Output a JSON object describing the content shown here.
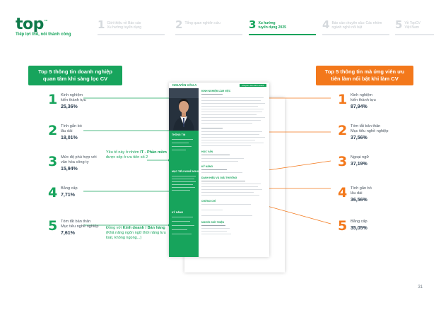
{
  "logo": {
    "text_top": "top",
    "text_cv": "cv",
    "tm": "™"
  },
  "tagline": "Tiếp lợi thế, nối thành công",
  "steps": [
    {
      "num": "1",
      "label": "Giới thiệu về Báo cáo\nXu hướng tuyển dụng",
      "active": false
    },
    {
      "num": "2",
      "label": "Tổng quan nghiên cứu",
      "active": false
    },
    {
      "num": "3",
      "label": "Xu hướng\ntuyển dụng 2025",
      "active": true
    },
    {
      "num": "4",
      "label": "Báo cáo chuyên sâu: Các nhóm\nngành nghề nổi bật",
      "active": false
    },
    {
      "num": "5",
      "label": "Về TopCV\nViệt Nam",
      "active": false
    }
  ],
  "left_box": "Top 5 thông tin doanh nghiệp\nquan tâm khi sàng lọc CV",
  "right_box": "Top 5 thông tin mà ứng viên ưu\ntiên làm nổi bật khi làm CV",
  "left_items": [
    {
      "num": "1",
      "label": "Kinh nghiệm\nkiến thành tựu",
      "pct": "25,36%"
    },
    {
      "num": "2",
      "label": "Tính gắn bó\nlâu dài",
      "pct": "18,01%"
    },
    {
      "num": "3",
      "label": "Mức độ phù hợp với\nvăn hóa công ty",
      "pct": "15,94%"
    },
    {
      "num": "4",
      "label": "Bằng cấp",
      "pct": "7,71%"
    },
    {
      "num": "5",
      "label": "Tóm tắt bản thân\nMục tiêu nghề nghiệp",
      "pct": "7,61%"
    }
  ],
  "right_items": [
    {
      "num": "1",
      "label": "Kinh nghiệm\nkiến thành tựu",
      "pct": "87,94%"
    },
    {
      "num": "2",
      "label": "Tóm tắt bản thân\nMục tiêu nghề nghiệp",
      "pct": "37,56%"
    },
    {
      "num": "3",
      "label": "Ngoại ngữ",
      "pct": "37,19%"
    },
    {
      "num": "4",
      "label": "Tính gắn bó\nlâu dài",
      "pct": "36,56%"
    },
    {
      "num": "5",
      "label": "Bằng cấp",
      "pct": "35,05%"
    }
  ],
  "callout_top": {
    "pre": "Yêu tố này ở nhóm ",
    "bold": "IT - Phần mềm",
    "post": "\nđược xếp ở ưu tiên số 2"
  },
  "callout_bottom": {
    "pre": "Đồng với ",
    "bold": "Kinh doanh / Bán hàng",
    "post": "\n(Khả năng ngôn ngữ thời năng lưu\nloát, không ngọng...)"
  },
  "cv": {
    "name": "NGUYỄN VĂN A",
    "role": "Chuyên viên kinh doanh",
    "sec_exp": "KINH NGHIỆM LÀM VIỆC",
    "sec_edu": "HỌC VẤN",
    "sec_skill": "KỸ NĂNG",
    "sec_hobby": "DANH HIỆU VÀ GIẢI THƯỞNG",
    "sec_cert": "CHỨNG CHỈ",
    "sec_ref": "NGƯỜI GIỚI THIỆU",
    "side_info": "THÔNG TIN",
    "side_goal": "MỤC TIÊU NGHỀ NGHIỆP",
    "side_skill": "KỸ NĂNG"
  },
  "page_number": "31",
  "colors": {
    "green": "#17a45c",
    "orange": "#f3781b"
  }
}
